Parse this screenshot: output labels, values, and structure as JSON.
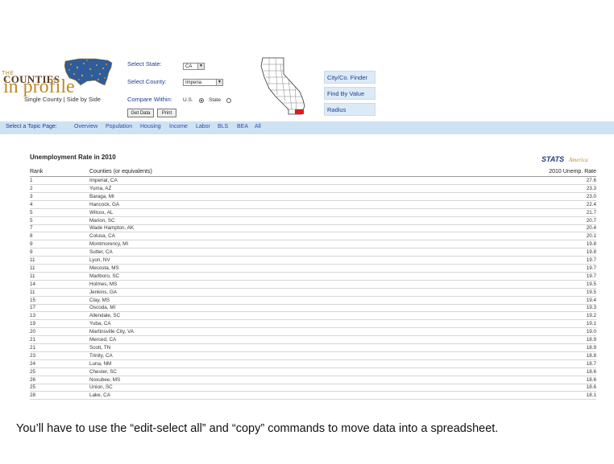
{
  "header": {
    "logo": {
      "small_text": "THE",
      "counties": "COUNTIES",
      "in_profile": "in profile",
      "tagline": "Single County | Side by Side"
    },
    "select_state_label": "Select State:",
    "state_value": "CA",
    "select_county_label": "Select County:",
    "county_value": "Imperia",
    "compare_within_label": "Compare Within:",
    "compare_us": "U.S.",
    "compare_state": "State",
    "get_data_label": "Get Data",
    "print_label": "Print",
    "city_finder_label": "City/Co. Finder",
    "find_by_value_label": "Find By Value",
    "radius_label": "Radius"
  },
  "topic_bar": {
    "label": "Select a Topic Page:",
    "links": [
      "Overview",
      "Population",
      "Housing",
      "Income",
      "Labor",
      "BLS",
      "BEA",
      "All"
    ]
  },
  "table": {
    "title": "Unemployment Rate in 2010",
    "logo_stats": "STATS",
    "logo_america": "America",
    "columns": [
      "Rank",
      "Counties (or equivalents)",
      "2010 Unemp. Rate"
    ],
    "rows": [
      [
        "1",
        "Imperial, CA",
        "27.6"
      ],
      [
        "2",
        "Yuma, AZ",
        "23.3"
      ],
      [
        "3",
        "Baraga, MI",
        "23.0"
      ],
      [
        "4",
        "Hancock, GA",
        "22.4"
      ],
      [
        "5",
        "Wilcox, AL",
        "21.7"
      ],
      [
        "5",
        "Marion, SC",
        "20.7"
      ],
      [
        "7",
        "Wade Hampton, AK",
        "20.4"
      ],
      [
        "8",
        "Colusa, CA",
        "20.1"
      ],
      [
        "9",
        "Montmorency, MI",
        "19.8"
      ],
      [
        "9",
        "Sutter, CA",
        "19.8"
      ],
      [
        "11",
        "Lyon, NV",
        "19.7"
      ],
      [
        "11",
        "Mecosta, MS",
        "19.7"
      ],
      [
        "11",
        "Marlboro, SC",
        "19.7"
      ],
      [
        "14",
        "Holmes, MS",
        "19.5"
      ],
      [
        "11",
        "Jenkins, GA",
        "19.5"
      ],
      [
        "15",
        "Clay, MS",
        "19.4"
      ],
      [
        "17",
        "Oscoda, MI",
        "19.3"
      ],
      [
        "13",
        "Allendale, SC",
        "19.2"
      ],
      [
        "19",
        "Yuba, CA",
        "19.1"
      ],
      [
        "20",
        "Martinsville City, VA",
        "19.0"
      ],
      [
        "21",
        "Merced, CA",
        "18.9"
      ],
      [
        "21",
        "Scott, TN",
        "18.9"
      ],
      [
        "23",
        "Trinity, CA",
        "18.8"
      ],
      [
        "24",
        "Luna, NM",
        "18.7"
      ],
      [
        "25",
        "Chester, SC",
        "18.6"
      ],
      [
        "26",
        "Noxubee, MS",
        "18.6"
      ],
      [
        "25",
        "Union, SC",
        "18.6"
      ],
      [
        "28",
        "Lake, CA",
        "18.1"
      ]
    ]
  },
  "footer_text": "You’ll have to use the “edit-select all” and “copy” commands to move data into a spreadsheet.",
  "colors": {
    "topic_bar": "#cfe2f3",
    "link_blue": "#2a4fa8",
    "logo_gold": "#c08a24",
    "map_red": "#e0191b"
  }
}
